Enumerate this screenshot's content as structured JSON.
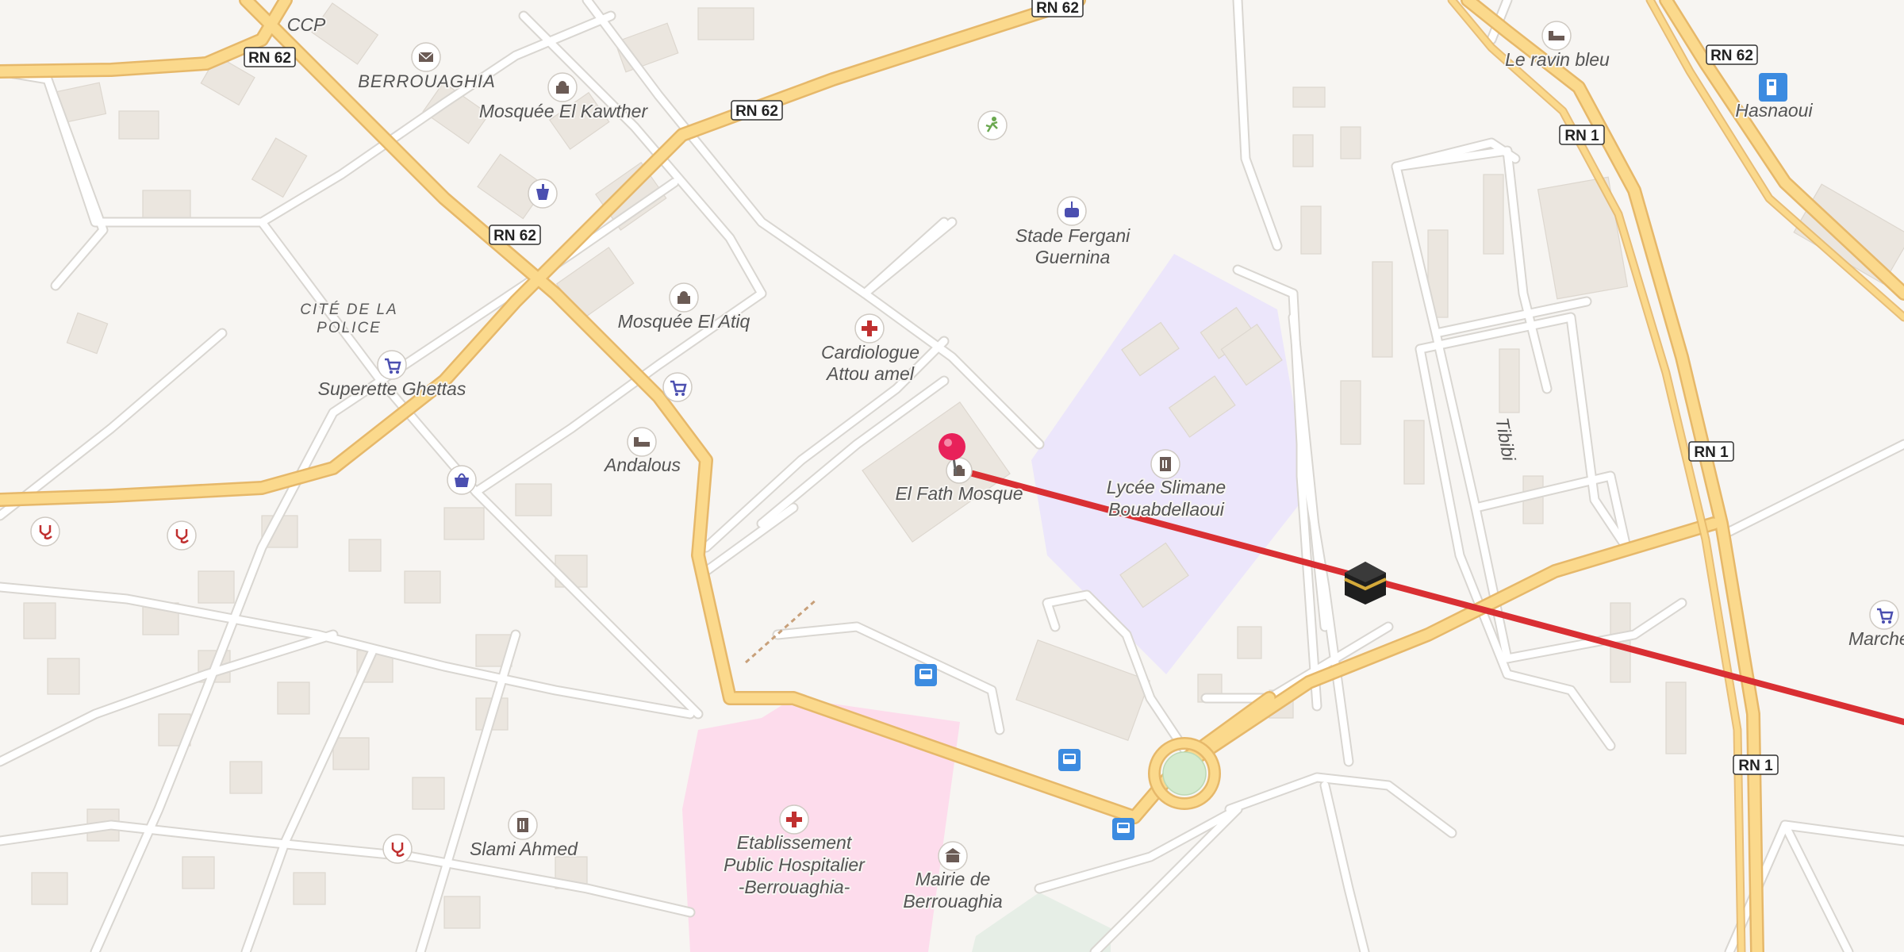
{
  "route": {
    "color": "#d92f33",
    "destination_icon": "kaaba-icon"
  },
  "pin": {
    "color": "#e8215a"
  },
  "road_shields": [
    {
      "label": "RN 62"
    },
    {
      "label": "RN 62"
    },
    {
      "label": "RN 62"
    },
    {
      "label": "RN 62"
    },
    {
      "label": "RN 62"
    },
    {
      "label": "RN 1"
    },
    {
      "label": "RN 1"
    },
    {
      "label": "RN 1"
    }
  ],
  "labels": {
    "ccp": "CCP",
    "berrouaghia": "BERROUAGHIA",
    "mosquee_el_kawther": "Mosquée El Kawther",
    "cite_police_1": "CITÉ DE LA",
    "cite_police_2": "POLICE",
    "mosquee_el_atiq": "Mosquée El Atiq",
    "superette": "Superette Ghettas",
    "andalous": "Andalous",
    "cardiologue_1": "Cardiologue",
    "cardiologue_2": "Attou amel",
    "stade_1": "Stade Fergani",
    "stade_2": "Guernina",
    "el_fath": "El Fath Mosque",
    "lycee_1": "Lycée Slimane",
    "lycee_2": "Bouabdellaoui",
    "tibibi": "Tibibi",
    "ravin": "Le ravin bleu",
    "hasnaoui": "Hasnaoui",
    "marche": "Marché Berr",
    "hopital_1": "Etablissement",
    "hopital_2": "Public Hospitalier",
    "hopital_3": "-Berrouaghia-",
    "mairie_1": "Mairie de",
    "mairie_2": "Berrouaghia",
    "slami": "Slami Ahmed"
  },
  "colors": {
    "land": "#f7f5f2",
    "major_road": "#fbd98c",
    "hospital_area": "#fddcec",
    "school_area": "#ece6fb",
    "poi_icon": "#4b4fb0",
    "medical_icon": "#c03030"
  }
}
